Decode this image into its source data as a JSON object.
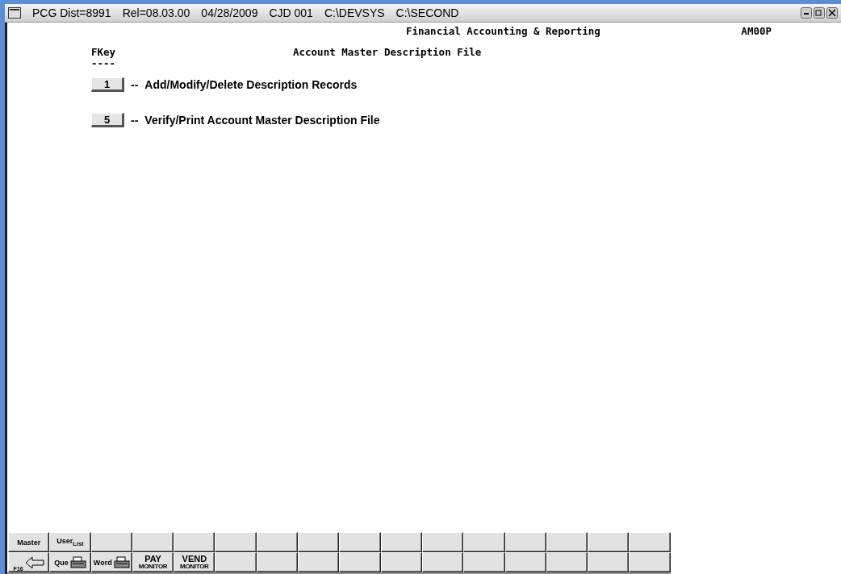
{
  "window": {
    "title_parts": [
      "PCG Dist=8991",
      "Rel=08.03.00",
      "04/28/2009",
      "CJD 001",
      "C:\\DEVSYS",
      "C:\\SECOND"
    ]
  },
  "header": {
    "system": "Financial Accounting & Reporting",
    "program": "AM00P"
  },
  "menu": {
    "fkey_heading": "FKey",
    "fkey_rule": "----",
    "title": "Account Master Description File",
    "options": [
      {
        "key": "1",
        "separator": "--",
        "label": "Add/Modify/Delete Description Records"
      },
      {
        "key": "5",
        "separator": "--",
        "label": "Verify/Print Account Master Description File"
      }
    ]
  },
  "toolbar": {
    "rows": [
      [
        {
          "kind": "text",
          "label": "Master"
        },
        {
          "kind": "text",
          "label": "User$_{List}$"
        },
        {
          "kind": "blank"
        },
        {
          "kind": "blank"
        },
        {
          "kind": "blank"
        },
        {
          "kind": "blank"
        },
        {
          "kind": "blank"
        },
        {
          "kind": "blank"
        },
        {
          "kind": "blank"
        },
        {
          "kind": "blank"
        },
        {
          "kind": "blank"
        },
        {
          "kind": "blank"
        },
        {
          "kind": "blank"
        },
        {
          "kind": "blank"
        },
        {
          "kind": "blank"
        },
        {
          "kind": "blank"
        }
      ],
      [
        {
          "kind": "back",
          "label": "F16"
        },
        {
          "kind": "printer",
          "label": "Que"
        },
        {
          "kind": "printer",
          "label": "Word"
        },
        {
          "kind": "monitor",
          "label": "PAY",
          "sub": "MONITOR"
        },
        {
          "kind": "monitor",
          "label": "VEND",
          "sub": "MONITOR"
        },
        {
          "kind": "blank"
        },
        {
          "kind": "blank"
        },
        {
          "kind": "blank"
        },
        {
          "kind": "blank"
        },
        {
          "kind": "blank"
        },
        {
          "kind": "blank"
        },
        {
          "kind": "blank"
        },
        {
          "kind": "blank"
        },
        {
          "kind": "blank"
        },
        {
          "kind": "blank"
        },
        {
          "kind": "blank"
        }
      ]
    ]
  }
}
